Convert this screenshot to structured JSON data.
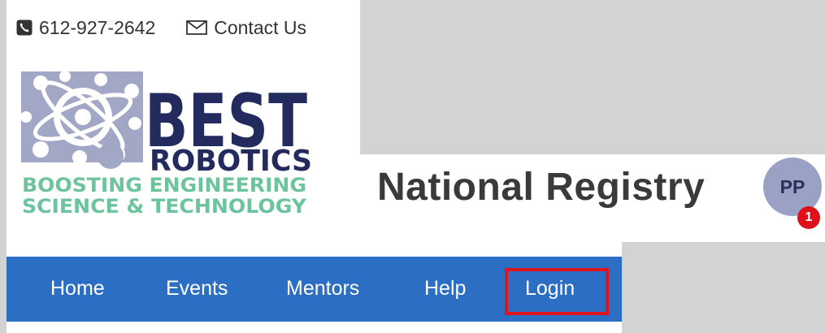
{
  "contact": {
    "phone": "612-927-2642",
    "contact_label": "Contact Us"
  },
  "logo": {
    "line1": "BEST",
    "line2": "ROBOTICS",
    "line3": "BOOSTING ENGINEERING",
    "line4": "SCIENCE & TECHNOLOGY"
  },
  "header": {
    "title": "National Registry"
  },
  "user": {
    "initials": "PP",
    "notification_count": "1"
  },
  "nav": {
    "items": [
      "Home",
      "Events",
      "Mentors",
      "Help",
      "Login"
    ]
  },
  "colors": {
    "nav_bg": "#2d6ec5",
    "logo_navy": "#232a5e",
    "logo_green": "#6cc49e",
    "logo_grey": "#a3a7c6",
    "highlight": "#e0141e",
    "badge": "#e0101a"
  },
  "icons": {
    "phone": "phone-icon",
    "mail": "mail-icon"
  }
}
